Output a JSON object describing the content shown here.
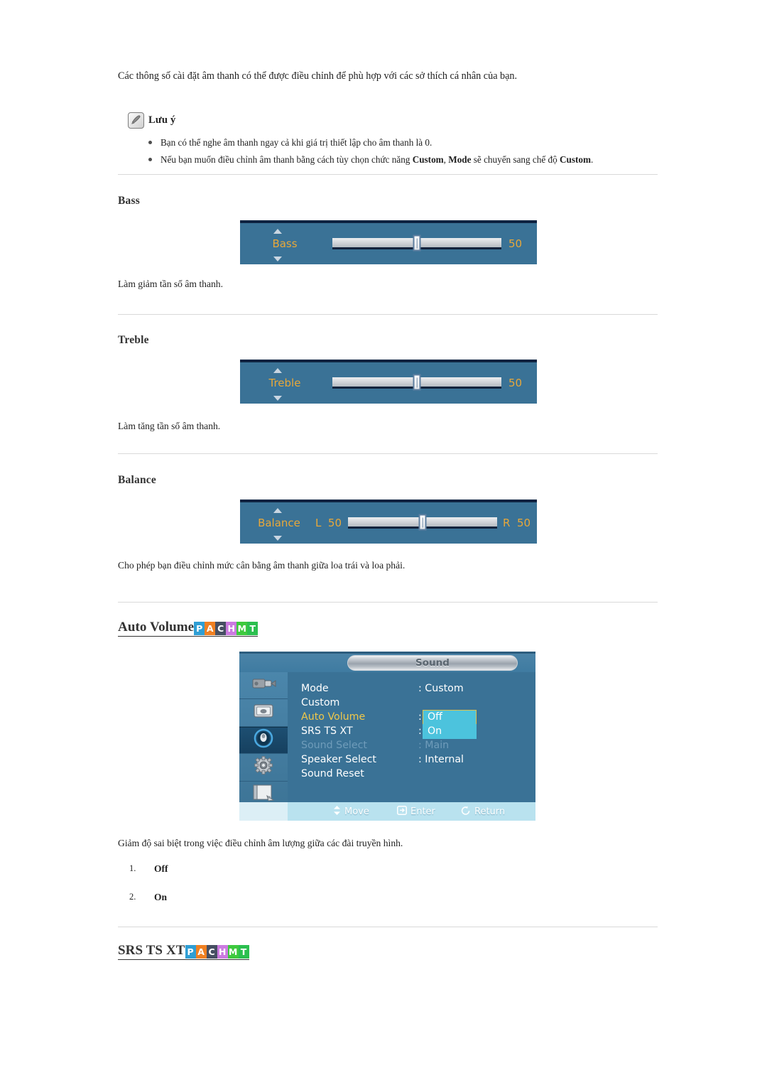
{
  "intro": "Các thông số cài đặt âm thanh có thể được điều chỉnh để phù hợp với các sở thích cá nhân của bạn.",
  "note": {
    "icon": "note-pen-icon",
    "title": "Lưu ý",
    "items": [
      "Bạn có thể nghe âm thanh ngay cả khi giá trị thiết lập cho âm thanh là 0.",
      "Nếu bạn muốn điều chỉnh âm thanh bằng cách tùy chọn chức năng Custom, Mode sẽ chuyển sang chế độ Custom."
    ],
    "bold_terms": [
      "Custom",
      "Mode",
      "Custom"
    ]
  },
  "sections": {
    "bass": {
      "heading": "Bass",
      "caption": "Làm giảm tần số âm thanh.",
      "osd": {
        "label": "Bass",
        "value": "50",
        "position_pct": 50
      }
    },
    "treble": {
      "heading": "Treble",
      "caption": "Làm tăng tần số âm thanh.",
      "osd": {
        "label": "Treble",
        "value": "50",
        "position_pct": 50
      }
    },
    "balance": {
      "heading": "Balance",
      "caption": "Cho phép bạn điều chỉnh mức cân bằng âm thanh giữa loa trái và loa phải.",
      "osd": {
        "label": "Balance",
        "left_label": "L",
        "left_value": "50",
        "right_label": "R",
        "right_value": "50",
        "position_pct": 50
      }
    }
  },
  "auto_volume": {
    "heading": "Auto Volume",
    "caption": "Giảm độ sai biệt trong việc điều chỉnh âm lượng giữa các đài truyền hình.",
    "options": [
      {
        "num": "1.",
        "label": "Off"
      },
      {
        "num": "2.",
        "label": "On"
      }
    ]
  },
  "srs": {
    "heading": "SRS TS XT"
  },
  "badges": [
    {
      "letter": "P",
      "color": "#2f9ed4"
    },
    {
      "letter": "A",
      "color": "#ef8022"
    },
    {
      "letter": "C",
      "color": "#464f63"
    },
    {
      "letter": "H",
      "color": "#cb7ae0"
    },
    {
      "letter": "M",
      "color": "#3ec93e"
    },
    {
      "letter": "T",
      "color": "#2bbf4f"
    }
  ],
  "osd_menu": {
    "title": "Sound",
    "sidebar_icons": [
      {
        "name": "input-connector-icon",
        "active": false
      },
      {
        "name": "picture-monitor-icon",
        "active": false
      },
      {
        "name": "sound-speaker-icon",
        "active": true
      },
      {
        "name": "setup-gear-icon",
        "active": false
      },
      {
        "name": "multi-control-icon",
        "active": false
      }
    ],
    "rows": [
      {
        "label": "Mode",
        "value": ": Custom",
        "state": "normal"
      },
      {
        "label": "Custom",
        "value": "",
        "state": "normal"
      },
      {
        "label": "Auto Volume",
        "value": ":",
        "state": "selected"
      },
      {
        "label": "SRS TS XT",
        "value": ":",
        "state": "normal"
      },
      {
        "label": "Sound Select",
        "value": ": Main",
        "state": "disabled"
      },
      {
        "label": "Speaker Select",
        "value": ": Internal",
        "state": "normal"
      },
      {
        "label": "Sound Reset",
        "value": "",
        "state": "normal"
      }
    ],
    "dropdown": {
      "highlighted": "Off",
      "second": "On"
    },
    "footer": [
      {
        "icon": "move-updown-icon",
        "label": "Move"
      },
      {
        "icon": "enter-key-icon",
        "label": "Enter"
      },
      {
        "icon": "return-arrow-icon",
        "label": "Return"
      }
    ],
    "colors": {
      "panel_blue": "#3a7296",
      "highlight_cyan": "#4cc3dd",
      "selected_gold": "#f0c84a",
      "footer_bar": "#b9e2ef"
    }
  }
}
